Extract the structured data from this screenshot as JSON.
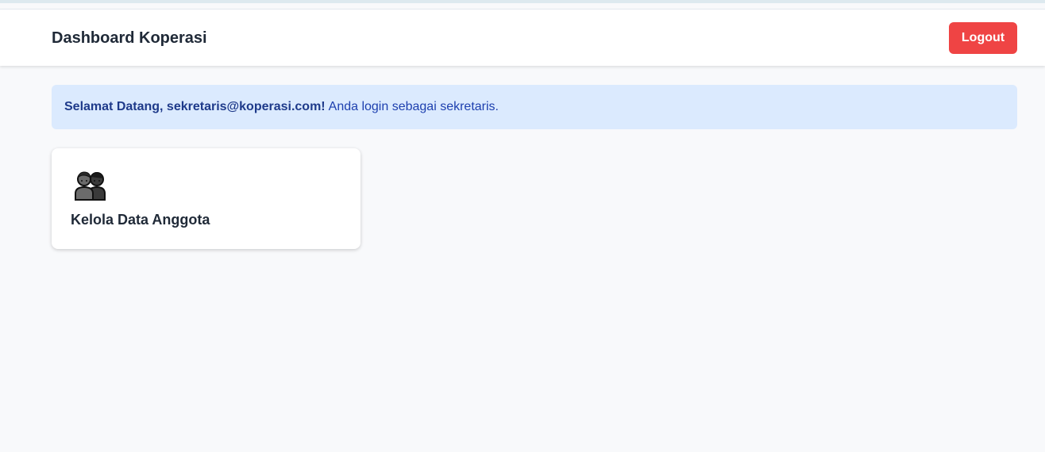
{
  "header": {
    "title": "Dashboard Koperasi",
    "logout_label": "Logout"
  },
  "alert": {
    "greeting": "Selamat Datang, sekretaris@koperasi.com!",
    "message": "Anda login sebagai sekretaris."
  },
  "cards": [
    {
      "icon": "people-icon",
      "label": "Kelola Data Anggota"
    }
  ],
  "colors": {
    "page_background": "#f8f9fb",
    "logout_button": "#ef4444",
    "alert_background": "#dbeafe",
    "alert_text": "#1e40af"
  }
}
